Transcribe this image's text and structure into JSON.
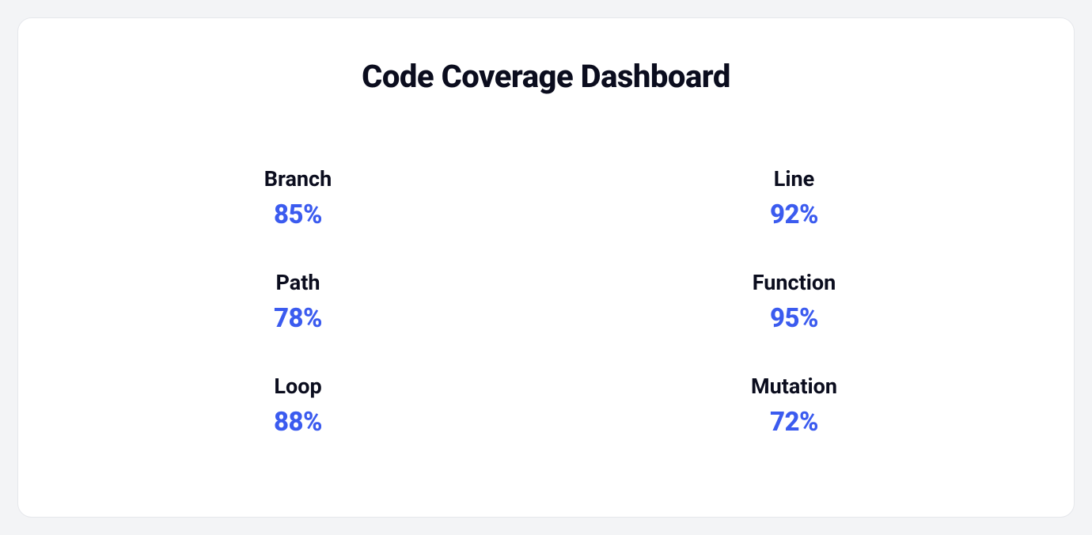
{
  "title": "Code Coverage Dashboard",
  "metrics": {
    "branch": {
      "label": "Branch",
      "value": "85%"
    },
    "line": {
      "label": "Line",
      "value": "92%"
    },
    "path": {
      "label": "Path",
      "value": "78%"
    },
    "function": {
      "label": "Function",
      "value": "95%"
    },
    "loop": {
      "label": "Loop",
      "value": "88%"
    },
    "mutation": {
      "label": "Mutation",
      "value": "72%"
    }
  },
  "colors": {
    "background": "#f3f4f6",
    "card": "#ffffff",
    "border": "#e5e7eb",
    "text": "#0b0d1e",
    "value": "#3b5bef"
  }
}
